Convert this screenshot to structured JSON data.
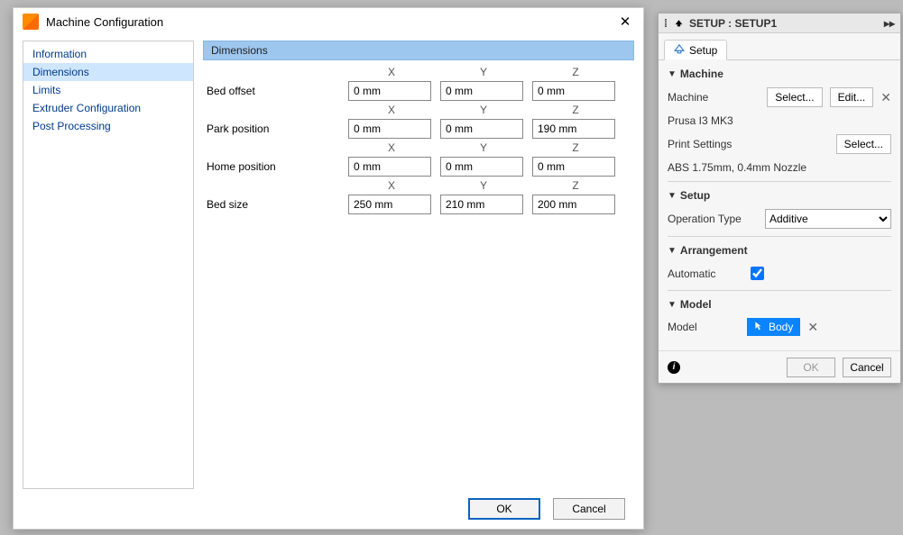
{
  "mc": {
    "title": "Machine Configuration",
    "sidebar": {
      "items": [
        {
          "label": "Information"
        },
        {
          "label": "Dimensions"
        },
        {
          "label": "Limits"
        },
        {
          "label": "Extruder Configuration"
        },
        {
          "label": "Post Processing"
        }
      ],
      "selected_index": 1
    },
    "section_title": "Dimensions",
    "cols": [
      "X",
      "Y",
      "Z"
    ],
    "rows": [
      {
        "label": "Bed offset",
        "values": {
          "x": "0 mm",
          "y": "0 mm",
          "z": "0 mm"
        }
      },
      {
        "label": "Park position",
        "values": {
          "x": "0 mm",
          "y": "0 mm",
          "z": "190 mm"
        }
      },
      {
        "label": "Home position",
        "values": {
          "x": "0 mm",
          "y": "0 mm",
          "z": "0 mm"
        }
      },
      {
        "label": "Bed size",
        "values": {
          "x": "250 mm",
          "y": "210 mm",
          "z": "200 mm"
        }
      }
    ],
    "ok_label": "OK",
    "cancel_label": "Cancel"
  },
  "setup": {
    "title": "SETUP : SETUP1",
    "tab_label": "Setup",
    "sections": {
      "machine": {
        "title": "Machine",
        "machine_label": "Machine",
        "select_label": "Select...",
        "edit_label": "Edit...",
        "machine_name": "Prusa I3 MK3",
        "print_settings_label": "Print Settings",
        "print_select_label": "Select...",
        "print_settings_name": "ABS 1.75mm, 0.4mm Nozzle"
      },
      "setup": {
        "title": "Setup",
        "operation_type_label": "Operation Type",
        "operation_type_value": "Additive"
      },
      "arrangement": {
        "title": "Arrangement",
        "automatic_label": "Automatic",
        "automatic_checked": true
      },
      "model": {
        "title": "Model",
        "model_label": "Model",
        "chip_label": "Body"
      }
    },
    "ok_label": "OK",
    "cancel_label": "Cancel"
  }
}
